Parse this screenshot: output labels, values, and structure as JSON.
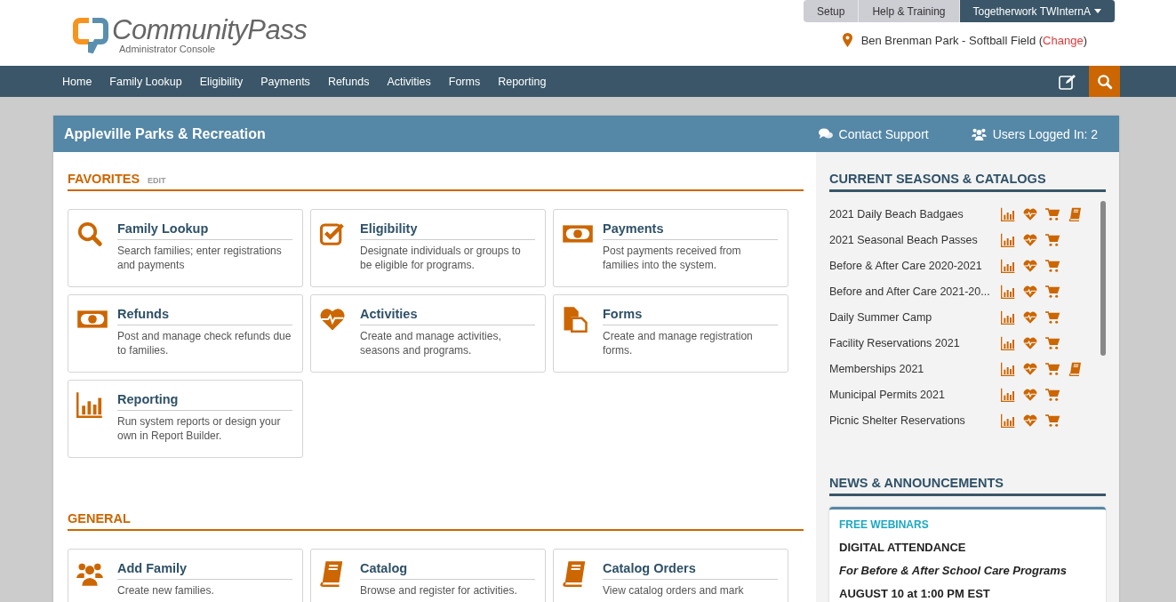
{
  "logo": {
    "name": "CommunityPass",
    "subtitle": "Administrator Console"
  },
  "top_tabs": [
    {
      "label": "Setup",
      "selected": false
    },
    {
      "label": "Help & Training",
      "selected": false
    },
    {
      "label": "Togetherwork TWInternA",
      "selected": true
    }
  ],
  "location": {
    "text": "Ben Brenman Park - Softball Field (",
    "link": "Change",
    "suffix": ")"
  },
  "nav": [
    "Home",
    "Family Lookup",
    "Eligibility",
    "Payments",
    "Refunds",
    "Activities",
    "Forms",
    "Reporting"
  ],
  "panel": {
    "title": "Appleville Parks & Recreation",
    "contact": "Contact Support",
    "users": "Users Logged In: 2"
  },
  "favorites": {
    "title": "FAVORITES",
    "edit": "EDIT",
    "cards": [
      {
        "kind": "search",
        "title": "Family Lookup",
        "description": "Search families; enter registrations and payments"
      },
      {
        "kind": "check",
        "title": "Eligibility",
        "description": "Designate individuals or groups to be eligible for programs."
      },
      {
        "kind": "money",
        "title": "Payments",
        "description": "Post payments received from families into the system."
      },
      {
        "kind": "money",
        "title": "Refunds",
        "description": "Post and manage check refunds due to families."
      },
      {
        "kind": "heart",
        "title": "Activities",
        "description": "Create and manage activities, seasons and programs."
      },
      {
        "kind": "forms",
        "title": "Forms",
        "description": "Create and manage registration forms."
      },
      {
        "kind": "chart",
        "title": "Reporting",
        "description": "Run system reports or design your own in Report Builder."
      }
    ]
  },
  "general": {
    "title": "GENERAL",
    "cards": [
      {
        "kind": "people",
        "title": "Add Family",
        "description": "Create new families."
      },
      {
        "kind": "book",
        "title": "Catalog",
        "description": "Browse and register for activities."
      },
      {
        "kind": "book",
        "title": "Catalog Orders",
        "description": "View catalog orders and mark"
      }
    ]
  },
  "seasons": {
    "title": "CURRENT SEASONS & CATALOGS",
    "items": [
      {
        "name": "2021 Daily Beach Badgaes",
        "catalog": true
      },
      {
        "name": "2021 Seasonal Beach Passes",
        "catalog": false
      },
      {
        "name": "Before & After Care 2020-2021",
        "catalog": false
      },
      {
        "name": "Before and After Care 2021-20...",
        "catalog": false
      },
      {
        "name": "Daily Summer Camp",
        "catalog": false
      },
      {
        "name": "Facility Reservations 2021",
        "catalog": false
      },
      {
        "name": "Memberships 2021",
        "catalog": true
      },
      {
        "name": "Municipal Permits 2021",
        "catalog": false
      },
      {
        "name": "Picnic Shelter Reservations",
        "catalog": false
      }
    ]
  },
  "news": {
    "title": "NEWS & ANNOUNCEMENTS",
    "label": "FREE WEBINARS",
    "headline": "DIGITAL ATTENDANCE",
    "subtitle": "For Before & After School Care Programs",
    "date": "AUGUST 10 at 1:00 PM EST"
  }
}
